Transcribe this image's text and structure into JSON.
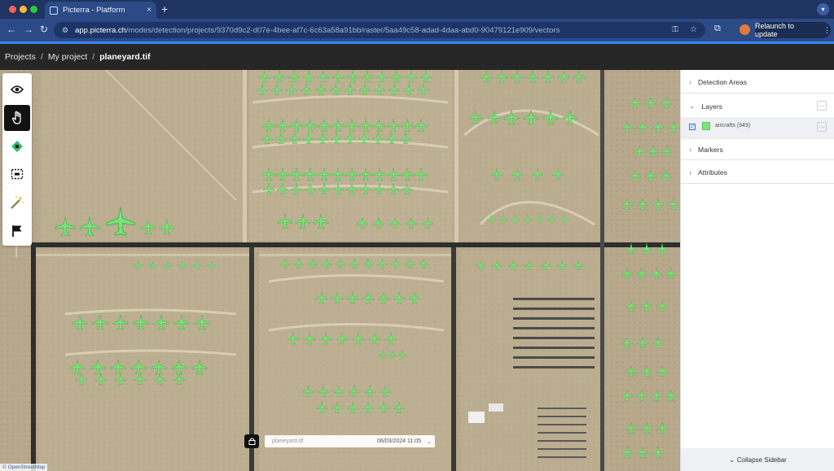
{
  "browser": {
    "tab_title": "Picterra - Platform",
    "url_domain": "app.picterra.ch",
    "url_path": "/modes/detection/projects/9370d9c2-d07e-4bee-af7c-6c63a58a91bb/raster/5aa49c58-adad-4daa-abd0-90479121e909/vectors",
    "relaunch_label": "Relaunch to update",
    "new_tab": "+",
    "close": "×"
  },
  "breadcrumb": {
    "projects": "Projects",
    "sep1": "/",
    "project": "My project",
    "sep2": "/",
    "file": "planeyard.tif"
  },
  "map_footer": {
    "raster_name": "planeyard.tif",
    "date": "06/03/2024 11:05",
    "attribution": "© OpenStreetMap"
  },
  "sidebar": {
    "detection_areas": "Detection Areas",
    "layers": "Layers",
    "layer_item": {
      "label": "aircrafts (949)",
      "color": "#7be37b",
      "checked": true
    },
    "markers": "Markers",
    "attributes": "Attributes",
    "collapse": "Collapse Sidebar"
  },
  "tools": [
    "eye-icon",
    "hand-icon",
    "point-icon",
    "rectangle-icon",
    "magic-wand-icon",
    "flag-icon"
  ],
  "colors": {
    "accent": "#3b82f6",
    "detection_green": "#7be37b",
    "terrain": "#b7a88c",
    "road": "#2e2e2e"
  }
}
